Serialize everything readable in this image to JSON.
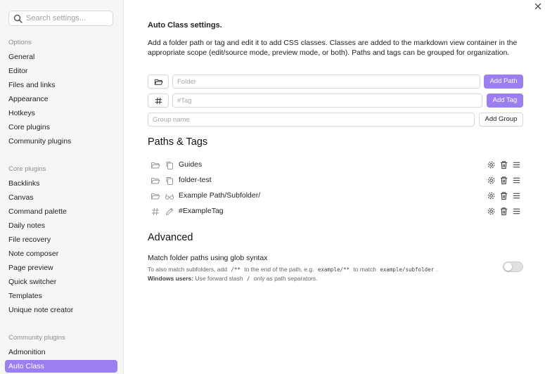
{
  "sidebar": {
    "search_placeholder": "Search settings...",
    "sections": [
      {
        "heading": "Options",
        "items": [
          "General",
          "Editor",
          "Files and links",
          "Appearance",
          "Hotkeys",
          "Core plugins",
          "Community plugins"
        ]
      },
      {
        "heading": "Core plugins",
        "items": [
          "Backlinks",
          "Canvas",
          "Command palette",
          "Daily notes",
          "File recovery",
          "Note composer",
          "Page preview",
          "Quick switcher",
          "Templates",
          "Unique note creator"
        ]
      },
      {
        "heading": "Community plugins",
        "items": [
          "Admonition",
          "Auto Class"
        ]
      }
    ],
    "active_item": "Auto Class"
  },
  "main": {
    "title": "Auto Class settings.",
    "description": "Add a folder path or tag and edit it to add CSS classes. Classes are added to the markdown view container in the appropriate scope (edit/source mode, preview mode, or both). Paths and tags can be grouped for organization.",
    "folder_placeholder": "Folder",
    "add_path_label": "Add Path",
    "tag_placeholder": "#Tag",
    "add_tag_label": "Add Tag",
    "group_placeholder": "Group name",
    "add_group_label": "Add Group",
    "paths_heading": "Paths & Tags",
    "entries": [
      {
        "kind": "folder",
        "scope_icon": "copy-icon",
        "label": "Guides"
      },
      {
        "kind": "folder",
        "scope_icon": "copy-icon",
        "label": "folder-test"
      },
      {
        "kind": "folder",
        "scope_icon": "glasses-icon",
        "label": "Example Path/Subfolder/"
      },
      {
        "kind": "tag",
        "scope_icon": "pencil-icon",
        "label": "#ExampleTag"
      }
    ],
    "advanced_heading": "Advanced",
    "glob_setting": {
      "name": "Match folder paths using glob syntax",
      "desc_part1": "To also match subfolders, add",
      "code1": "/**",
      "desc_part2": "to the end of the path, e.g.",
      "code2": "example/**",
      "desc_part3": "to match",
      "code3": "example/subfolder",
      "desc_part4": ".",
      "bold_label": "Windows users:",
      "desc_part5": "Use forward slash",
      "code4": "/",
      "desc_part6": "only as path separators.",
      "enabled": false
    }
  },
  "colors": {
    "accent": "#9b7ef0",
    "sidebar_bg": "#f6f6f6"
  }
}
